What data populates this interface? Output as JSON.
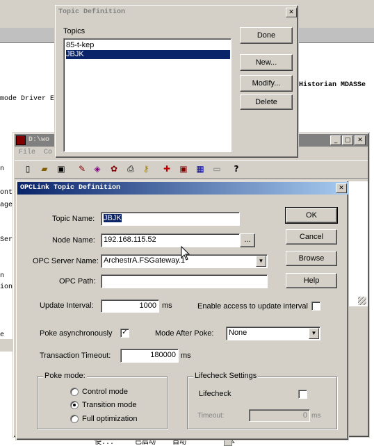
{
  "background": {
    "side_text_1": "n",
    "side_text_2": "ont",
    "side_text_3": "age",
    "side_text_4": "Ser",
    "side_text_5": "n",
    "side_text_6": "ion",
    "side_text_7": "e",
    "mode_driver": "mode Driver E",
    "historian": "Historian MDASSe",
    "bottom_row": "使...     已启动    自动          本"
  },
  "topic_def": {
    "title": "Topic Definition",
    "topics_label": "Topics",
    "topics": [
      "85-t-kep",
      "JBJK"
    ],
    "selected_index": 1,
    "done": "Done",
    "new": "New...",
    "modify": "Modify...",
    "delete": "Delete"
  },
  "app_window": {
    "title": "D:\\wo",
    "menu_file": "File",
    "menu_co": "Co",
    "toolbar_icons": [
      "new-file-icon",
      "open-folder-icon",
      "save-icon",
      "edit-icon",
      "import-icon",
      "config-icon",
      "print-icon",
      "key-icon",
      "add-icon",
      "floppy-icon",
      "db-icon",
      "monitor-icon",
      "help-icon"
    ],
    "help_glyph": "?"
  },
  "opclink": {
    "title": "OPCLink Topic Definition",
    "topic_name_label": "Topic Name:",
    "topic_name_value": "JBJK",
    "node_name_label": "Node Name:",
    "node_name_value": "192.168.115.52",
    "browse_dots": "...",
    "opc_server_label": "OPC Server Name:",
    "opc_server_value": "ArchestrA.FSGateway.1",
    "opc_path_label": "OPC Path:",
    "opc_path_value": "",
    "ok": "OK",
    "cancel": "Cancel",
    "browse": "Browse",
    "help": "Help",
    "update_interval_label": "Update Interval:",
    "update_interval_value": "1000",
    "ms1": "ms",
    "enable_access_label": "Enable access to update interval",
    "enable_access_checked": false,
    "poke_async_label": "Poke asynchronously",
    "poke_async_checked": true,
    "mode_after_poke_label": "Mode After Poke:",
    "mode_after_poke_value": "None",
    "transaction_timeout_label": "Transaction Timeout:",
    "transaction_timeout_value": "180000",
    "ms2": "ms",
    "poke_mode_title": "Poke mode:",
    "poke_modes": [
      "Control mode",
      "Transition mode",
      "Full optimization"
    ],
    "poke_mode_selected": 1,
    "lifecheck_title": "Lifecheck Settings",
    "lifecheck_label": "Lifecheck",
    "lifecheck_checked": false,
    "timeout_label": "Timeout:",
    "timeout_value": "0",
    "ms3": "ms"
  },
  "colors": {
    "title_active_start": "#0a246a",
    "title_active_end": "#a6caf0",
    "title_inactive": "#808080",
    "face": "#d4d0c8",
    "selection": "#0a246a"
  }
}
